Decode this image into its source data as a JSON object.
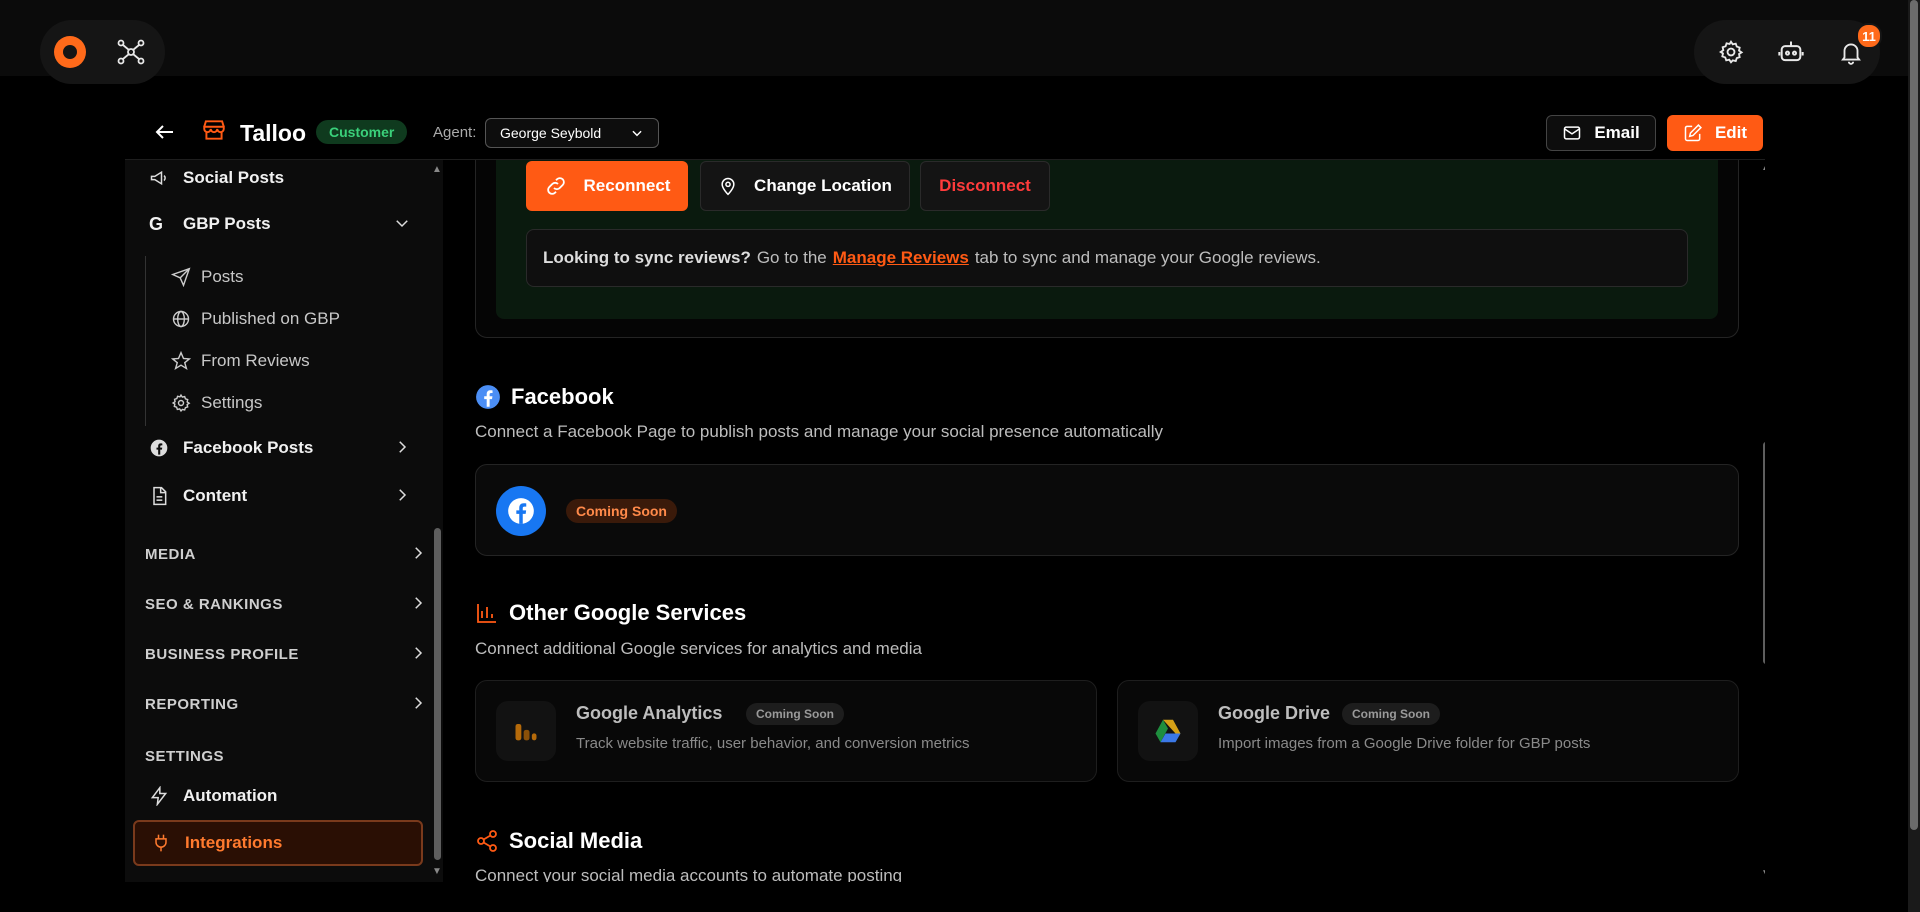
{
  "topbar": {
    "notifications_count": "11"
  },
  "header": {
    "business_name": "Talloo",
    "badge": "Customer",
    "agent_label": "Agent:",
    "agent_value": "George Seybold",
    "email_label": "Email",
    "edit_label": "Edit"
  },
  "sidebar": {
    "social_posts": "Social Posts",
    "gbp_posts": "GBP Posts",
    "gbp_sub": [
      "Posts",
      "Published on GBP",
      "From Reviews",
      "Settings"
    ],
    "facebook_posts": "Facebook Posts",
    "content": "Content",
    "sections": [
      "MEDIA",
      "SEO & RANKINGS",
      "BUSINESS PROFILE",
      "REPORTING"
    ],
    "settings_heading": "SETTINGS",
    "automation": "Automation",
    "integrations": "Integrations"
  },
  "gbp": {
    "reconnect": "Reconnect",
    "change_location": "Change Location",
    "disconnect": "Disconnect",
    "sync_bold": "Looking to sync reviews?",
    "sync_pre": "Go to the",
    "sync_link": "Manage Reviews",
    "sync_post": "tab to sync and manage your Google reviews."
  },
  "facebook": {
    "title": "Facebook",
    "desc": "Connect a Facebook Page to publish posts and manage your social presence automatically",
    "badge": "Coming Soon"
  },
  "google_services": {
    "title": "Other Google Services",
    "desc": "Connect additional Google services for analytics and media",
    "items": [
      {
        "name": "Google Analytics",
        "badge": "Coming Soon",
        "desc": "Track website traffic, user behavior, and conversion metrics"
      },
      {
        "name": "Google Drive",
        "badge": "Coming Soon",
        "desc": "Import images from a Google Drive folder for GBP posts"
      }
    ]
  },
  "social_media": {
    "title": "Social Media",
    "desc": "Connect your social media accounts to automate posting"
  },
  "colors": {
    "accent": "#ff5a14",
    "success": "#3ad07a",
    "danger": "#ff3b3b",
    "facebook": "#1877f2"
  }
}
